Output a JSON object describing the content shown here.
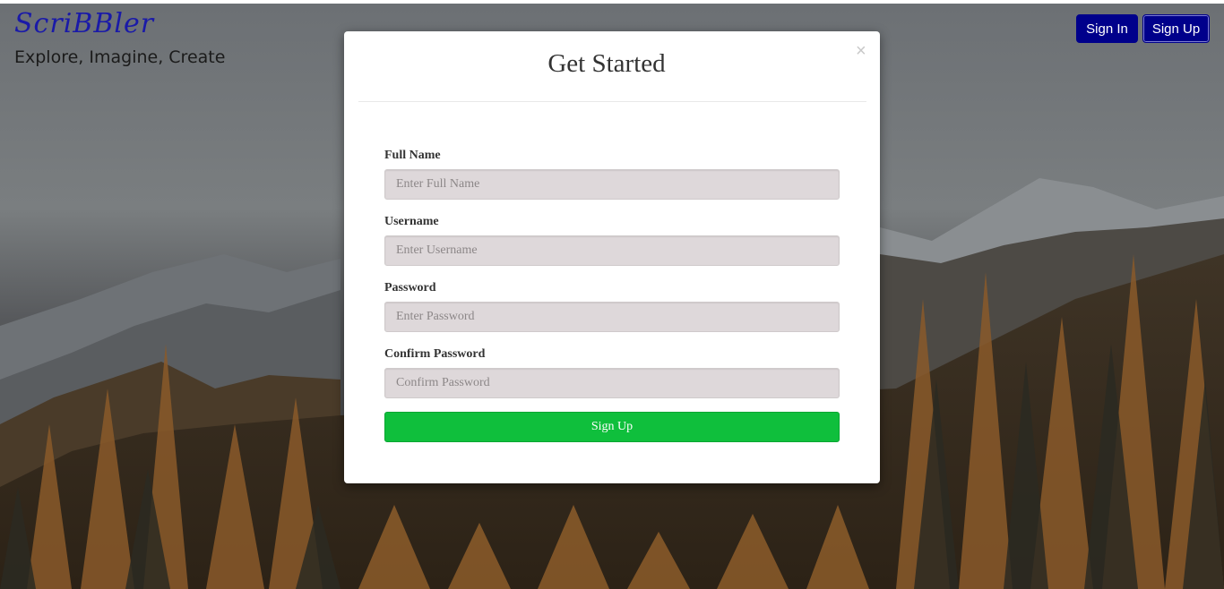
{
  "header": {
    "logo_text": "ScriBBler",
    "tagline": "Explore, Imagine, Create",
    "signin_label": "Sign In",
    "signup_label": "Sign Up"
  },
  "modal": {
    "title": "Get Started",
    "close_glyph": "×",
    "fields": [
      {
        "label": "Full Name",
        "placeholder": "Enter Full Name",
        "value": ""
      },
      {
        "label": "Username",
        "placeholder": "Enter Username",
        "value": ""
      },
      {
        "label": "Password",
        "placeholder": "Enter Password",
        "value": ""
      },
      {
        "label": "Confirm Password",
        "placeholder": "Confirm Password",
        "value": ""
      }
    ],
    "submit_label": "Sign Up"
  },
  "colors": {
    "nav_button": "#00008b",
    "logo": "#1a1aa8",
    "submit": "#0fbf3c",
    "input_bg": "#ded8da"
  }
}
